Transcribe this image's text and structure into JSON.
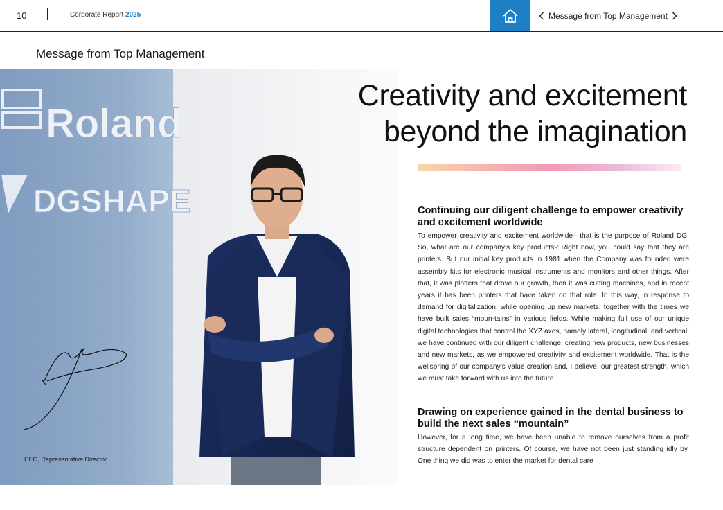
{
  "header": {
    "page_number": "10",
    "report_title": "Corporate Report",
    "report_year": "2025",
    "home_icon": "home-icon",
    "nav_title": "Message from Top Management",
    "prev_icon": "chevron-left-icon",
    "next_icon": "chevron-right-icon",
    "accent_color": "#1f7fc4"
  },
  "page": {
    "section_heading": "Message from Top Management",
    "headline_line1": "Creativity and excitement",
    "headline_line2": "beyond the imagination"
  },
  "photo": {
    "wall_logo_top": "Roland",
    "wall_logo_bottom": "DGSHAPE",
    "caption": "CEO, Representative Director",
    "signature_icon": "signature-icon"
  },
  "sections": [
    {
      "heading": "Continuing our diligent challenge to empower creativity and excitement worldwide",
      "body": "To empower creativity and excitement worldwide—that is the purpose of Roland DG. So, what are our company’s key products? Right now, you could say that they are printers. But our initial key products in 1981 when the Company was founded were assembly kits for electronic musical instruments and monitors and other things. After that, it was plotters that drove our growth, then it was cutting machines, and in recent years it has been printers that have taken on that role. In this way, in response to demand for digitalization, while opening up new markets, together with the times we have built sales “moun-tains” in various fields. While making full use of our unique digital technologies that control the XYZ axes, namely lateral, longitudinal, and vertical, we have continued with our diligent challenge, creating new products, new businesses and new markets, as we empowered creativity and excitement worldwide. That is the wellspring of our company’s value creation and, I believe, our greatest strength, which we must take forward with us into the future."
    },
    {
      "heading": "Drawing on experience gained in the dental business to build the next sales “mountain”",
      "body": "However, for a long time, we have been unable to remove ourselves from a profit structure dependent on printers. Of course, we have not been just standing idly by. One thing we did was to enter the market for dental care"
    }
  ]
}
